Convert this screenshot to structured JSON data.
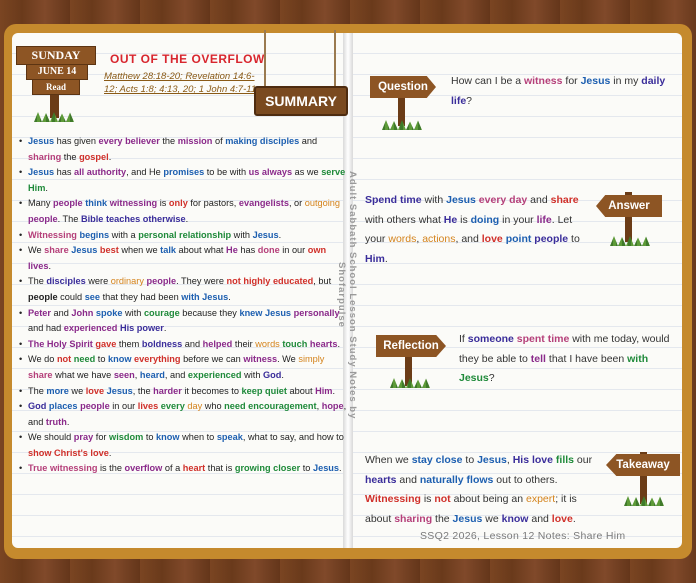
{
  "day_sign": {
    "day": "SUNDAY",
    "date": "JUNE 14",
    "read": "Read"
  },
  "title": "OUT OF THE OVERFLOW",
  "references": "Matthew 28:18-20; Revelation 14:6-12; Acts 1:8; 4:13, 20; 1 John 4:7-11",
  "summary_sign": "SUMMARY",
  "side_text": "Adult Sabbath School Lesson Study Notes by Shofarpulse",
  "summary_points": [
    [
      [
        "c1",
        "Jesus"
      ],
      [
        "",
        "has given"
      ],
      [
        "c2",
        "every believer"
      ],
      [
        "",
        "the"
      ],
      [
        "c2",
        "mission"
      ],
      [
        "",
        "of"
      ],
      [
        "c1",
        "making disciples"
      ],
      [
        "",
        "and"
      ],
      [
        "c7",
        "sharing"
      ],
      [
        "",
        "the"
      ],
      [
        "c3",
        "gospel"
      ],
      [
        "",
        "."
      ]
    ],
    [
      [
        "c1",
        "Jesus"
      ],
      [
        "",
        "has"
      ],
      [
        "c2",
        "all authority"
      ],
      [
        "",
        ", and He"
      ],
      [
        "c1",
        "promises"
      ],
      [
        "",
        "to be with"
      ],
      [
        "c2",
        "us"
      ],
      [
        "c2",
        "always"
      ],
      [
        "",
        "as we"
      ],
      [
        "c4",
        "serve Him"
      ],
      [
        "",
        "."
      ]
    ],
    [
      [
        "",
        "Many"
      ],
      [
        "c2",
        "people"
      ],
      [
        "c1",
        "think"
      ],
      [
        "c2",
        "witnessing"
      ],
      [
        "",
        "is"
      ],
      [
        "c3",
        "only"
      ],
      [
        "",
        "for pastors,"
      ],
      [
        "c2",
        "evangelists"
      ],
      [
        "",
        ", or"
      ],
      [
        "c5",
        "outgoing"
      ],
      [
        "c2",
        "people"
      ],
      [
        "",
        ". The"
      ],
      [
        "c6",
        "Bible teaches otherwise"
      ],
      [
        "",
        "."
      ]
    ],
    [
      [
        "c7",
        "Witnessing"
      ],
      [
        "c1",
        "begins"
      ],
      [
        "",
        "with a"
      ],
      [
        "c4",
        "personal relationship"
      ],
      [
        "",
        "with"
      ],
      [
        "c1",
        "Jesus"
      ],
      [
        "",
        "."
      ]
    ],
    [
      [
        "",
        "We"
      ],
      [
        "c7",
        "share"
      ],
      [
        "c1",
        "Jesus"
      ],
      [
        "c3",
        "best"
      ],
      [
        "",
        "when we"
      ],
      [
        "c1",
        "talk"
      ],
      [
        "",
        "about what"
      ],
      [
        "c2",
        "He"
      ],
      [
        "",
        "has"
      ],
      [
        "c7",
        "done"
      ],
      [
        "",
        "in our"
      ],
      [
        "c3",
        "own"
      ],
      [
        "c2",
        "lives"
      ],
      [
        "",
        "."
      ]
    ],
    [
      [
        "",
        "The"
      ],
      [
        "c6",
        "disciples"
      ],
      [
        "",
        "were"
      ],
      [
        "c5",
        "ordinary"
      ],
      [
        "c2",
        "people"
      ],
      [
        "",
        ". They were"
      ],
      [
        "c3",
        "not highly educated"
      ],
      [
        "",
        ", but"
      ],
      [
        "b",
        "people"
      ],
      [
        "",
        "could"
      ],
      [
        "c1",
        "see"
      ],
      [
        "",
        "that they had been"
      ],
      [
        "c1",
        "with Jesus"
      ],
      [
        "",
        "."
      ]
    ],
    [
      [
        "c2",
        "Peter"
      ],
      [
        "",
        "and"
      ],
      [
        "c2",
        "John"
      ],
      [
        "c1",
        "spoke"
      ],
      [
        "",
        "with"
      ],
      [
        "c4",
        "courage"
      ],
      [
        "",
        "because they"
      ],
      [
        "c1",
        "knew Jesus"
      ],
      [
        "c2",
        "personally"
      ],
      [
        "",
        "and had"
      ],
      [
        "c2",
        "experienced"
      ],
      [
        "c6",
        "His power"
      ],
      [
        "",
        "."
      ]
    ],
    [
      [
        "c2",
        "The Holy Spirit"
      ],
      [
        "c3",
        "gave"
      ],
      [
        "",
        "them"
      ],
      [
        "c6",
        "boldness"
      ],
      [
        "",
        "and"
      ],
      [
        "c2",
        "helped"
      ],
      [
        "",
        "their"
      ],
      [
        "c5",
        "words"
      ],
      [
        "c4",
        "touch"
      ],
      [
        "c2",
        "hearts"
      ],
      [
        "",
        "."
      ]
    ],
    [
      [
        "",
        "We do"
      ],
      [
        "c3",
        "not"
      ],
      [
        "c4",
        "need"
      ],
      [
        "",
        "to"
      ],
      [
        "c1",
        "know"
      ],
      [
        "c3",
        "everything"
      ],
      [
        "",
        "before we can"
      ],
      [
        "c2",
        "witness"
      ],
      [
        "",
        ". We"
      ],
      [
        "c5",
        "simply"
      ],
      [
        "c7",
        "share"
      ],
      [
        "",
        "what we have"
      ],
      [
        "c2",
        "seen"
      ],
      [
        "",
        ","
      ],
      [
        "c1",
        "heard"
      ],
      [
        "",
        ", and"
      ],
      [
        "c4",
        "experienced"
      ],
      [
        "",
        "with"
      ],
      [
        "c6",
        "God"
      ],
      [
        "",
        "."
      ]
    ],
    [
      [
        "",
        "The"
      ],
      [
        "c1",
        "more"
      ],
      [
        "",
        "we"
      ],
      [
        "c3",
        "love"
      ],
      [
        "c1",
        "Jesus"
      ],
      [
        "",
        ", the"
      ],
      [
        "c2",
        "harder"
      ],
      [
        "",
        "it becomes to"
      ],
      [
        "c4",
        "keep quiet"
      ],
      [
        "",
        "about"
      ],
      [
        "c2",
        "Him"
      ],
      [
        "",
        "."
      ]
    ],
    [
      [
        "c6",
        "God"
      ],
      [
        "c1",
        "places"
      ],
      [
        "c2",
        "people"
      ],
      [
        "",
        "in our"
      ],
      [
        "c3",
        "lives"
      ],
      [
        "c4",
        "every"
      ],
      [
        "c5",
        "day"
      ],
      [
        "",
        "who"
      ],
      [
        "c4",
        "need encouragement"
      ],
      [
        "",
        ","
      ],
      [
        "c2",
        "hope"
      ],
      [
        "",
        ", and"
      ],
      [
        "c2",
        "truth"
      ],
      [
        "",
        "."
      ]
    ],
    [
      [
        "",
        "We should"
      ],
      [
        "c2",
        "pray"
      ],
      [
        "",
        "for"
      ],
      [
        "c4",
        "wisdom"
      ],
      [
        "",
        "to"
      ],
      [
        "c1",
        "know"
      ],
      [
        "",
        "when to"
      ],
      [
        "c1",
        "speak"
      ],
      [
        "",
        ", what to say, and how to"
      ],
      [
        "c3",
        "show Christ's love"
      ],
      [
        "",
        "."
      ]
    ],
    [
      [
        "c7",
        "True witnessing"
      ],
      [
        "",
        "is the"
      ],
      [
        "c2",
        "overflow"
      ],
      [
        "",
        "of a"
      ],
      [
        "c3",
        "heart"
      ],
      [
        "",
        "that is"
      ],
      [
        "c4",
        "growing closer"
      ],
      [
        "",
        "to"
      ],
      [
        "c1",
        "Jesus"
      ],
      [
        "",
        "."
      ]
    ]
  ],
  "question": {
    "sign": "Question",
    "text": [
      [
        "",
        "How can I be a"
      ],
      [
        "c7",
        "witness"
      ],
      [
        "",
        "for"
      ],
      [
        "c1",
        "Jesus"
      ],
      [
        "",
        "in my"
      ],
      [
        "c6",
        "daily life"
      ],
      [
        "",
        "?"
      ]
    ]
  },
  "answer": {
    "sign": "Answer",
    "text": [
      [
        "c6",
        "Spend time"
      ],
      [
        "",
        "with"
      ],
      [
        "c1",
        "Jesus"
      ],
      [
        "c7",
        "every day"
      ],
      [
        "",
        "and"
      ],
      [
        "c3",
        "share"
      ],
      [
        "",
        "with others what"
      ],
      [
        "c6",
        "He"
      ],
      [
        "",
        "is"
      ],
      [
        "c1",
        "doing"
      ],
      [
        "",
        "in your"
      ],
      [
        "c2",
        "life"
      ],
      [
        "",
        ". Let your"
      ],
      [
        "c5",
        "words"
      ],
      [
        "",
        ","
      ],
      [
        "c5",
        "actions"
      ],
      [
        "",
        ", and"
      ],
      [
        "c3",
        "love"
      ],
      [
        "c1",
        "point"
      ],
      [
        "c6",
        "people"
      ],
      [
        "",
        "to"
      ],
      [
        "c6",
        "Him"
      ],
      [
        "",
        "."
      ]
    ]
  },
  "reflection": {
    "sign": "Reflection",
    "text": [
      [
        "",
        "If"
      ],
      [
        "c6",
        "someone"
      ],
      [
        "c7",
        "spent time"
      ],
      [
        "",
        "with me today, would they be able to"
      ],
      [
        "c2",
        "tell"
      ],
      [
        "",
        "that I have been"
      ],
      [
        "c4",
        "with Jesus"
      ],
      [
        "",
        "?"
      ]
    ]
  },
  "takeaway": {
    "sign": "Takeaway",
    "text": [
      [
        "",
        "When we"
      ],
      [
        "c1",
        "stay close"
      ],
      [
        "",
        "to"
      ],
      [
        "c1",
        "Jesus"
      ],
      [
        "",
        ","
      ],
      [
        "c6",
        "His love"
      ],
      [
        "c4",
        "fills"
      ],
      [
        "",
        "our"
      ],
      [
        "c6",
        "hearts"
      ],
      [
        "",
        "and"
      ],
      [
        "c1",
        "naturally flows"
      ],
      [
        "",
        "out to others."
      ],
      [
        "c3",
        "Witnessing"
      ],
      [
        "",
        "is"
      ],
      [
        "c3",
        "not"
      ],
      [
        "",
        "about being an"
      ],
      [
        "c5",
        "expert"
      ],
      [
        "",
        "; it is about"
      ],
      [
        "c7",
        "sharing"
      ],
      [
        "",
        "the"
      ],
      [
        "c1",
        "Jesus"
      ],
      [
        "",
        "we"
      ],
      [
        "c6",
        "know"
      ],
      [
        "",
        "and"
      ],
      [
        "c3",
        "love"
      ],
      [
        "",
        "."
      ]
    ]
  },
  "footer": "SSQ2 2026, Lesson 12 Notes: Share Him",
  "colors": {
    "red": "#d0302a",
    "blue": "#1d5fb0",
    "purple": "#8a2a8a",
    "green": "#1f8a3a",
    "orange": "#d4831c",
    "indigo": "#3a2d9a",
    "wood": "#8d5524",
    "cover": "#c58a2d"
  }
}
